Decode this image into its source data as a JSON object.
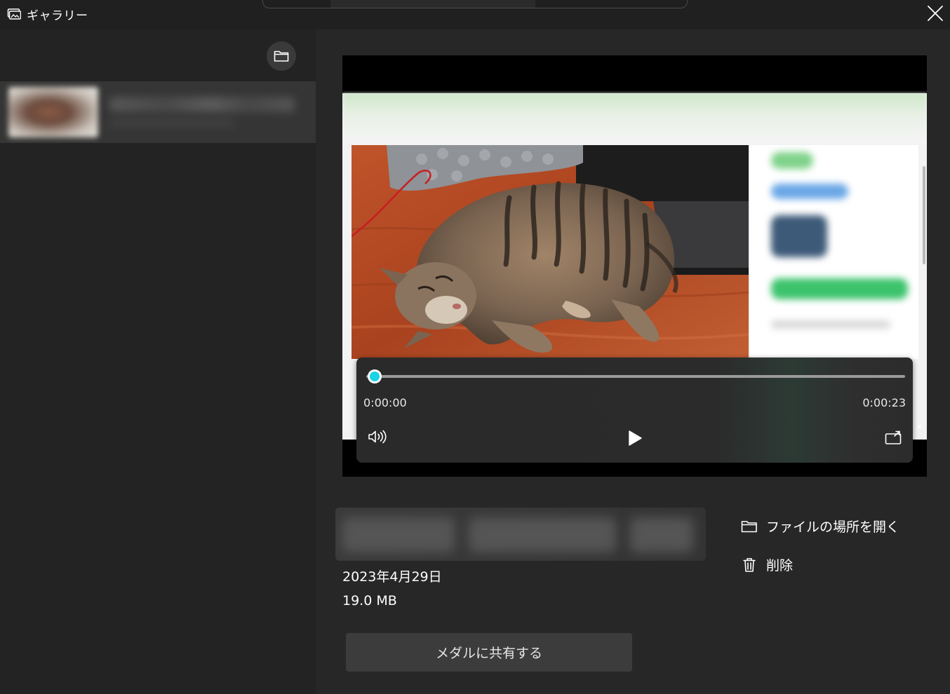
{
  "window": {
    "title": "ギャラリー",
    "title_icon": "gallery-icon",
    "close_icon": "close-icon"
  },
  "sidebar": {
    "folder_button_icon": "folder-icon",
    "items": [
      {
        "selected": true,
        "thumbnail": "blurred-thumbnail",
        "title_blurred": true
      }
    ]
  },
  "player": {
    "time_current": "0:00:00",
    "time_total": "0:00:23",
    "progress_fraction": 0.0,
    "accent_color": "#19d3e6",
    "volume_icon": "volume-icon",
    "play_icon": "play-icon",
    "cast_icon": "cast-icon",
    "mini_close_label": "×"
  },
  "details": {
    "date": "2023年4月29日",
    "size": "19.0 MB",
    "share_label": "メダルに共有する"
  },
  "actions": {
    "open_location_label": "ファイルの場所を開く",
    "delete_label": "削除"
  }
}
